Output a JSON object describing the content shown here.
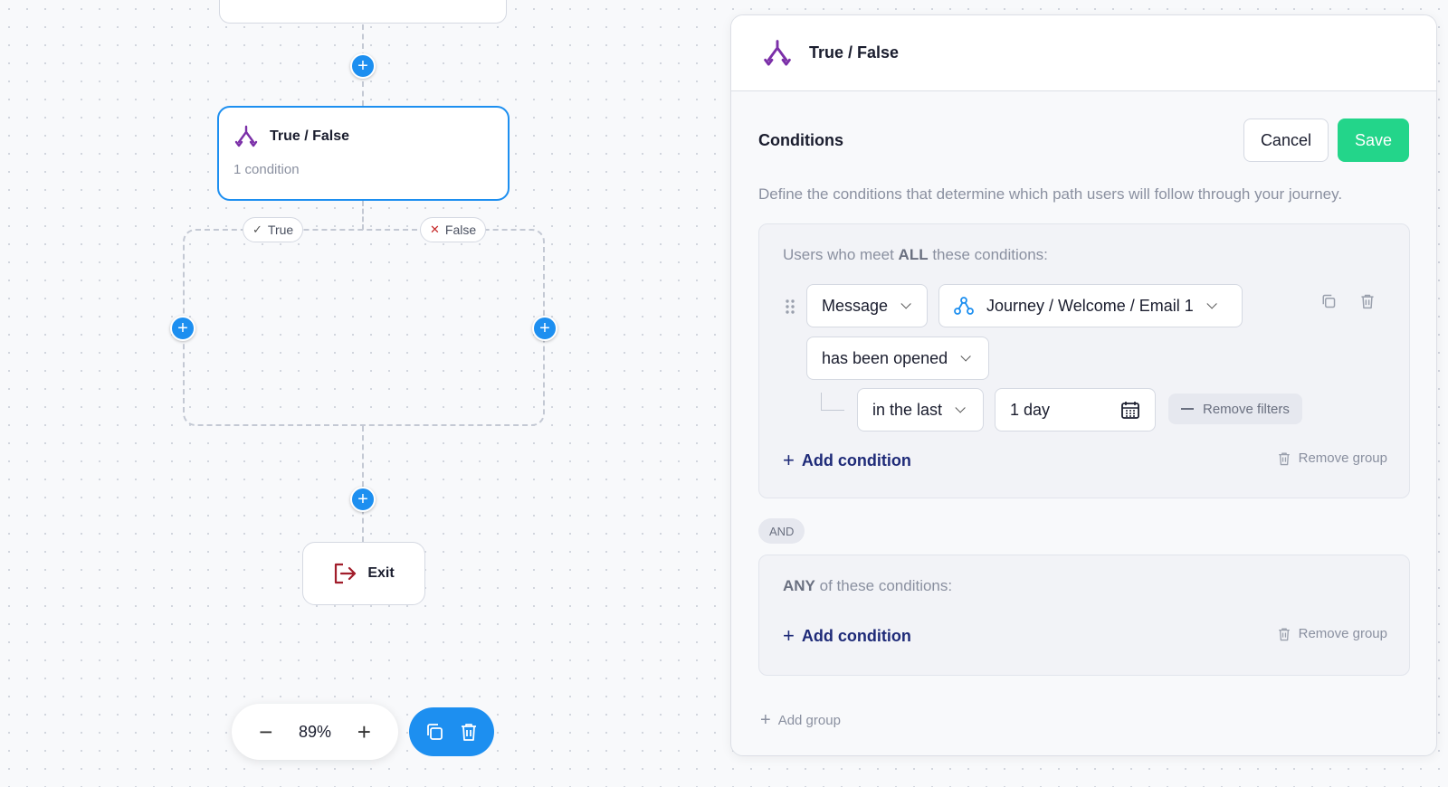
{
  "canvas": {
    "tf_node": {
      "title": "True / False",
      "subtitle": "1 condition"
    },
    "true_label": "True",
    "false_label": "False",
    "exit_label": "Exit",
    "zoom": {
      "level": "89%",
      "minus": "−",
      "plus": "+"
    }
  },
  "panel": {
    "header_title": "True / False",
    "section_title": "Conditions",
    "cancel_label": "Cancel",
    "save_label": "Save",
    "description": "Define the conditions that determine which path users will follow through your journey.",
    "group1": {
      "label_pre": "Users who meet ",
      "label_bold": "ALL",
      "label_post": " these conditions:",
      "field_select": "Message",
      "message_select": "Journey / Welcome / Email 1",
      "event_select": "has been opened",
      "time_operator": "in the last",
      "time_value": "1 day",
      "remove_filters": "Remove filters",
      "add_condition": "Add condition",
      "remove_group": "Remove group"
    },
    "and_badge": "AND",
    "group2": {
      "label_bold": "ANY",
      "label_post": " of these conditions:",
      "add_condition": "Add condition",
      "remove_group": "Remove group"
    },
    "add_group": "Add group"
  },
  "colors": {
    "accent": "#1d8ff0",
    "save": "#23d58a",
    "brand_icon": "#7b2fa8",
    "exit_icon": "#a11d2b"
  }
}
